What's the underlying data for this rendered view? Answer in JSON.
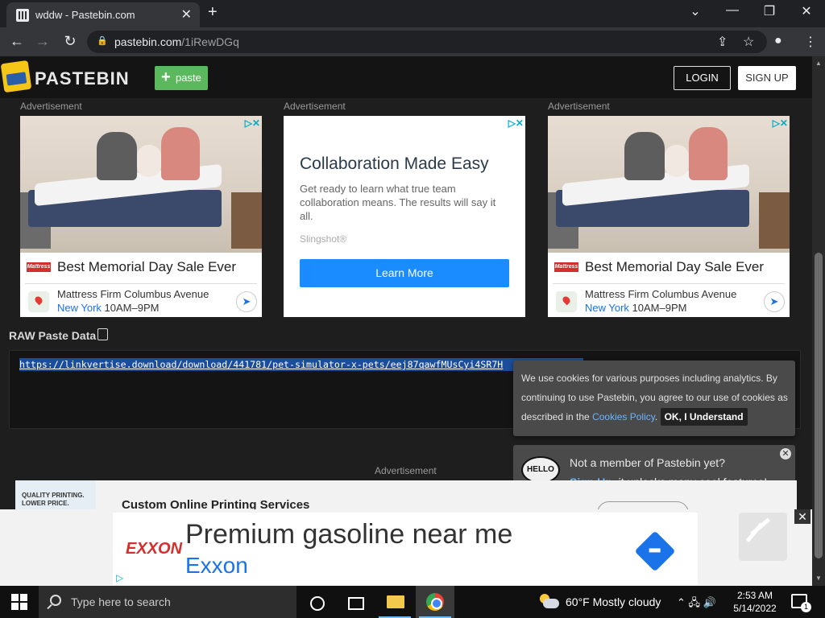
{
  "browser": {
    "tab_title": "wddw - Pastebin.com",
    "tab_close": "✕",
    "new_tab": "+",
    "url_host": "pastebin.com",
    "url_path": "/1iRewDGq",
    "minimize": "—",
    "restore": "❐",
    "close": "✕",
    "dropdown": "⌄"
  },
  "header": {
    "brand": "PASTEBIN",
    "paste_button": "paste",
    "login": "LOGIN",
    "signup": "SIGN UP"
  },
  "ads": {
    "label": "Advertisement",
    "mattress": {
      "headline": "Best Memorial Day Sale Ever",
      "brand": "Mattress Firm",
      "store": "Mattress Firm Columbus Avenue",
      "city": "New York",
      "hours": "10AM–9PM"
    },
    "collab": {
      "headline": "Collaboration Made Easy",
      "body": "Get ready to learn what true team collaboration means. The results will say it all.",
      "sponsor": "Slingshot®",
      "cta": "Learn More"
    },
    "print": {
      "thumb": "QUALITY PRINTING. LOWER PRICE.",
      "title": "Custom Online Printing Services"
    },
    "bottom": {
      "brand": "EXXON",
      "headline": "Premium gasoline near me",
      "subline": "Exxon"
    }
  },
  "paste": {
    "raw_label": "RAW Paste Data",
    "content": "https://linkvertise.download/download/441781/pet-simulator-x-pets/eej87qawfMUsCyi4SR7H"
  },
  "cookie": {
    "text_before": "We use cookies for various purposes including analytics. By continuing to use Pastebin, you agree to our use of cookies as described in the ",
    "link": "Cookies Policy",
    "text_after": ".",
    "ok_button": "OK, I Understand"
  },
  "signup_prompt": {
    "icon_text": "HELLO",
    "line1": "Not a member of Pastebin yet?",
    "link": "Sign Up",
    "line2": ", it unlocks many cool features!"
  },
  "taskbar": {
    "search_placeholder": "Type here to search",
    "weather": "60°F  Mostly cloudy",
    "time": "2:53 AM",
    "date": "5/14/2022",
    "notifications": "1"
  }
}
